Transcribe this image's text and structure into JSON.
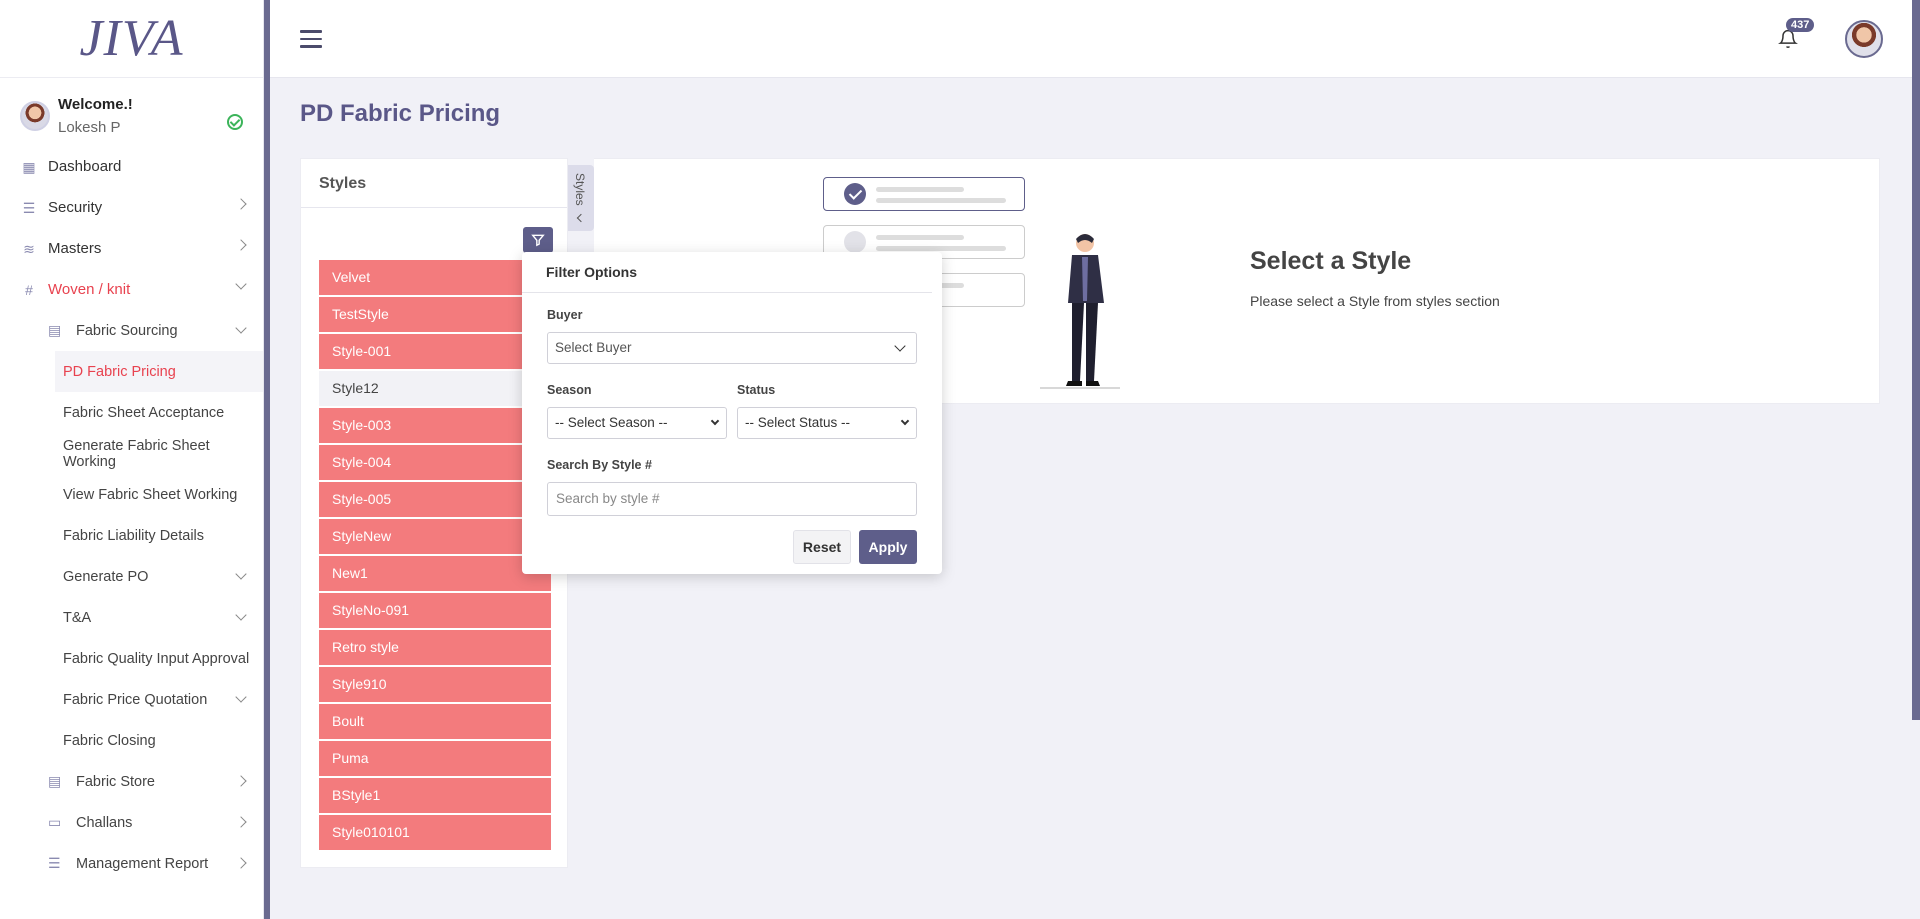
{
  "app": {
    "logo": "JIVA"
  },
  "profile": {
    "welcome": "Welcome.!",
    "name": "Lokesh P"
  },
  "menu": {
    "dashboard": "Dashboard",
    "security": "Security",
    "masters": "Masters",
    "woven_knit": "Woven / knit",
    "fabric_sourcing": "Fabric Sourcing",
    "leaves": [
      "PD Fabric Pricing",
      "Fabric Sheet Acceptance",
      "Generate Fabric Sheet Working",
      "View Fabric Sheet Working",
      "Fabric Liability Details",
      "Generate PO",
      "T&A",
      "Fabric Quality Input Approval",
      "Fabric Price Quotation",
      "Fabric Closing"
    ],
    "fabric_store": "Fabric Store",
    "challans": "Challans",
    "management_report": "Management Report"
  },
  "header": {
    "notification_count": "437"
  },
  "page": {
    "title": "PD Fabric Pricing"
  },
  "styles_panel": {
    "heading": "Styles",
    "tab_label": "Styles",
    "items": [
      "Velvet",
      "TestStyle",
      "Style-001",
      "Style12",
      "Style-003",
      "Style-004",
      "Style-005",
      "StyleNew",
      "New1",
      "StyleNo-091",
      "Retro style",
      "Style910",
      "Boult",
      "Puma",
      "BStyle1",
      "Style010101"
    ],
    "selected": "Style12"
  },
  "empty_state": {
    "title": "Select a Style",
    "description": "Please select a Style from styles section"
  },
  "filter": {
    "title": "Filter Options",
    "buyer_label": "Buyer",
    "buyer_value": "Select Buyer",
    "season_label": "Season",
    "season_value": "-- Select Season --",
    "status_label": "Status",
    "status_value": "-- Select Status --",
    "search_label": "Search By Style #",
    "search_placeholder": "Search by style #",
    "reset": "Reset",
    "apply": "Apply"
  },
  "colors": {
    "accent": "#5e5e8a",
    "danger": "#e8424f",
    "style_item": "#f37b7d"
  }
}
